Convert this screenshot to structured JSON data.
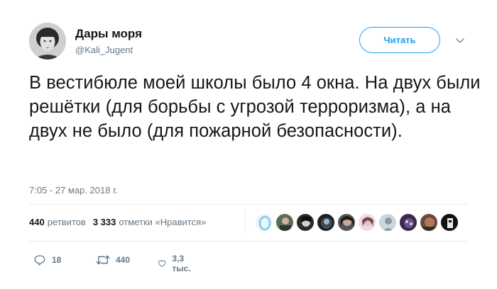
{
  "author": {
    "display_name": "Дары моря",
    "handle": "@Kali_Jugent"
  },
  "follow_button_label": "Читать",
  "tweet_text": "В вестибюле моей школы было 4 окна. На двух были решётки (для борьбы с угрозой терроризма), а на двух не было (для пожарной безопасности).",
  "timestamp": "7:05 - 27 мар. 2018 г.",
  "stats": {
    "retweets_count": "440",
    "retweets_label": "ретвитов",
    "likes_count": "3 333",
    "likes_label": "отметки «Нравится»"
  },
  "actions": {
    "reply_count": "18",
    "retweet_count": "440",
    "like_count": "3,3 тыс."
  },
  "colors": {
    "accent": "#1da1f2",
    "secondary_text": "#657786",
    "divider": "#e6ecf0"
  },
  "icons": [
    "chevron-down-icon",
    "reply-icon",
    "retweet-icon",
    "heart-icon"
  ]
}
